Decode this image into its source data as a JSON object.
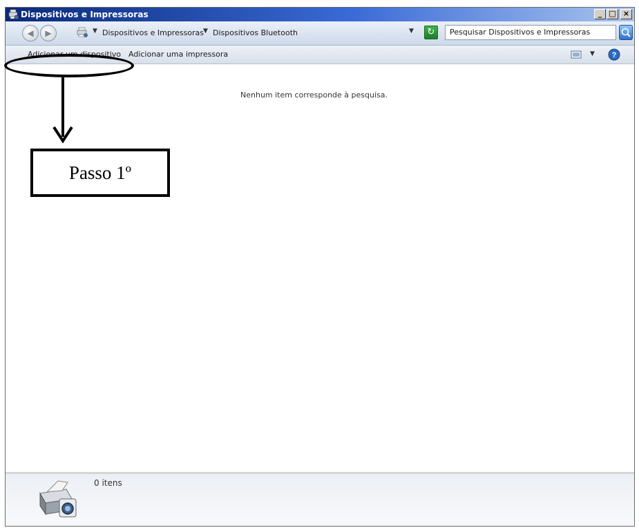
{
  "window": {
    "title": "Dispositivos e Impressoras",
    "controls": [
      "_",
      "□",
      "×"
    ]
  },
  "address_bar": {
    "breadcrumbs": [
      "Dispositivos e Impressoras",
      "Dispositivos Bluetooth"
    ],
    "search_placeholder": "Pesquisar Dispositivos e Impressoras"
  },
  "command_bar": {
    "add_device_label": "Adicionar um dispositivo",
    "add_printer_label": "Adicionar uma impressora",
    "icons": [
      "view-options-icon",
      "chevron-down-icon",
      "help-icon"
    ]
  },
  "content": {
    "empty_message": "Nenhum item corresponde à pesquisa."
  },
  "details_pane": {
    "item_count": "0 itens",
    "icon": "printer-camera-icon"
  },
  "annotation": {
    "step_label": "Passo 1º"
  },
  "colors": {
    "title_bar_start": "#0a2a7a",
    "title_bar_end": "#a9c4ee",
    "refresh_green": "#2e9a3a"
  }
}
